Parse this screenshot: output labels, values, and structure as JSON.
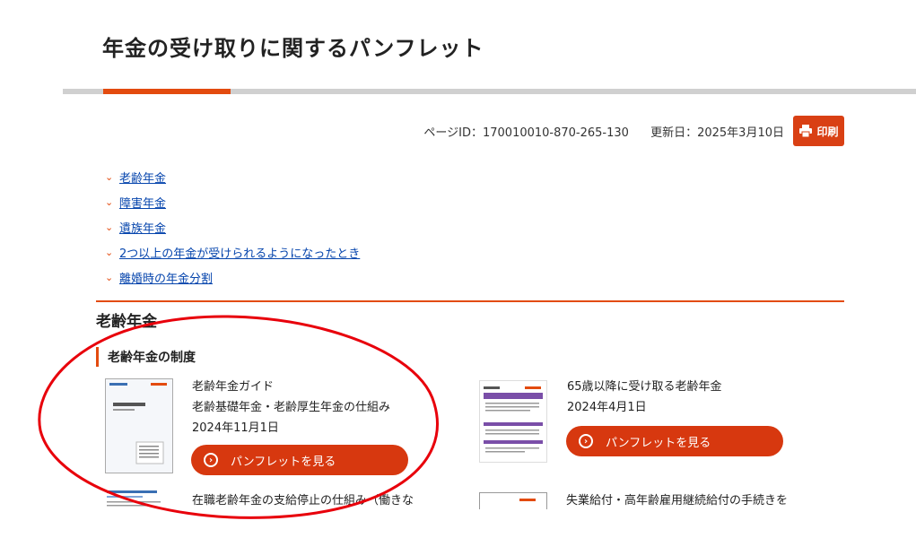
{
  "page": {
    "title": "年金の受け取りに関するパンフレット"
  },
  "meta": {
    "page_id_label": "ページID：",
    "page_id": "170010010-870-265-130",
    "updated_label": "更新日：",
    "updated": "2025年3月10日",
    "print_label": "印刷"
  },
  "anchors": [
    {
      "label": "老齢年金"
    },
    {
      "label": "障害年金"
    },
    {
      "label": "遺族年金"
    },
    {
      "label": "2つ以上の年金が受けられるようになったとき"
    },
    {
      "label": "離婚時の年金分割"
    }
  ],
  "section": {
    "title": "老齢年金",
    "subsection": "老齢年金の制度"
  },
  "cards": [
    {
      "title": "老齢年金ガイド",
      "subtitle": "老齢基礎年金・老齢厚生年金の仕組み",
      "date": "2024年11月1日",
      "button_label": "パンフレットを見る"
    },
    {
      "title": "65歳以降に受け取る老齢年金",
      "date": "2024年4月1日",
      "button_label": "パンフレットを見る"
    },
    {
      "title": "在職老齢年金の支給停止の仕組み（働きな"
    },
    {
      "title": "失業給付・高年齢雇用継続給付の手続きを"
    }
  ],
  "colors": {
    "accent": "#e34b0f",
    "button": "#d7380f",
    "link": "#0645ad",
    "annotation": "#e8000b"
  }
}
